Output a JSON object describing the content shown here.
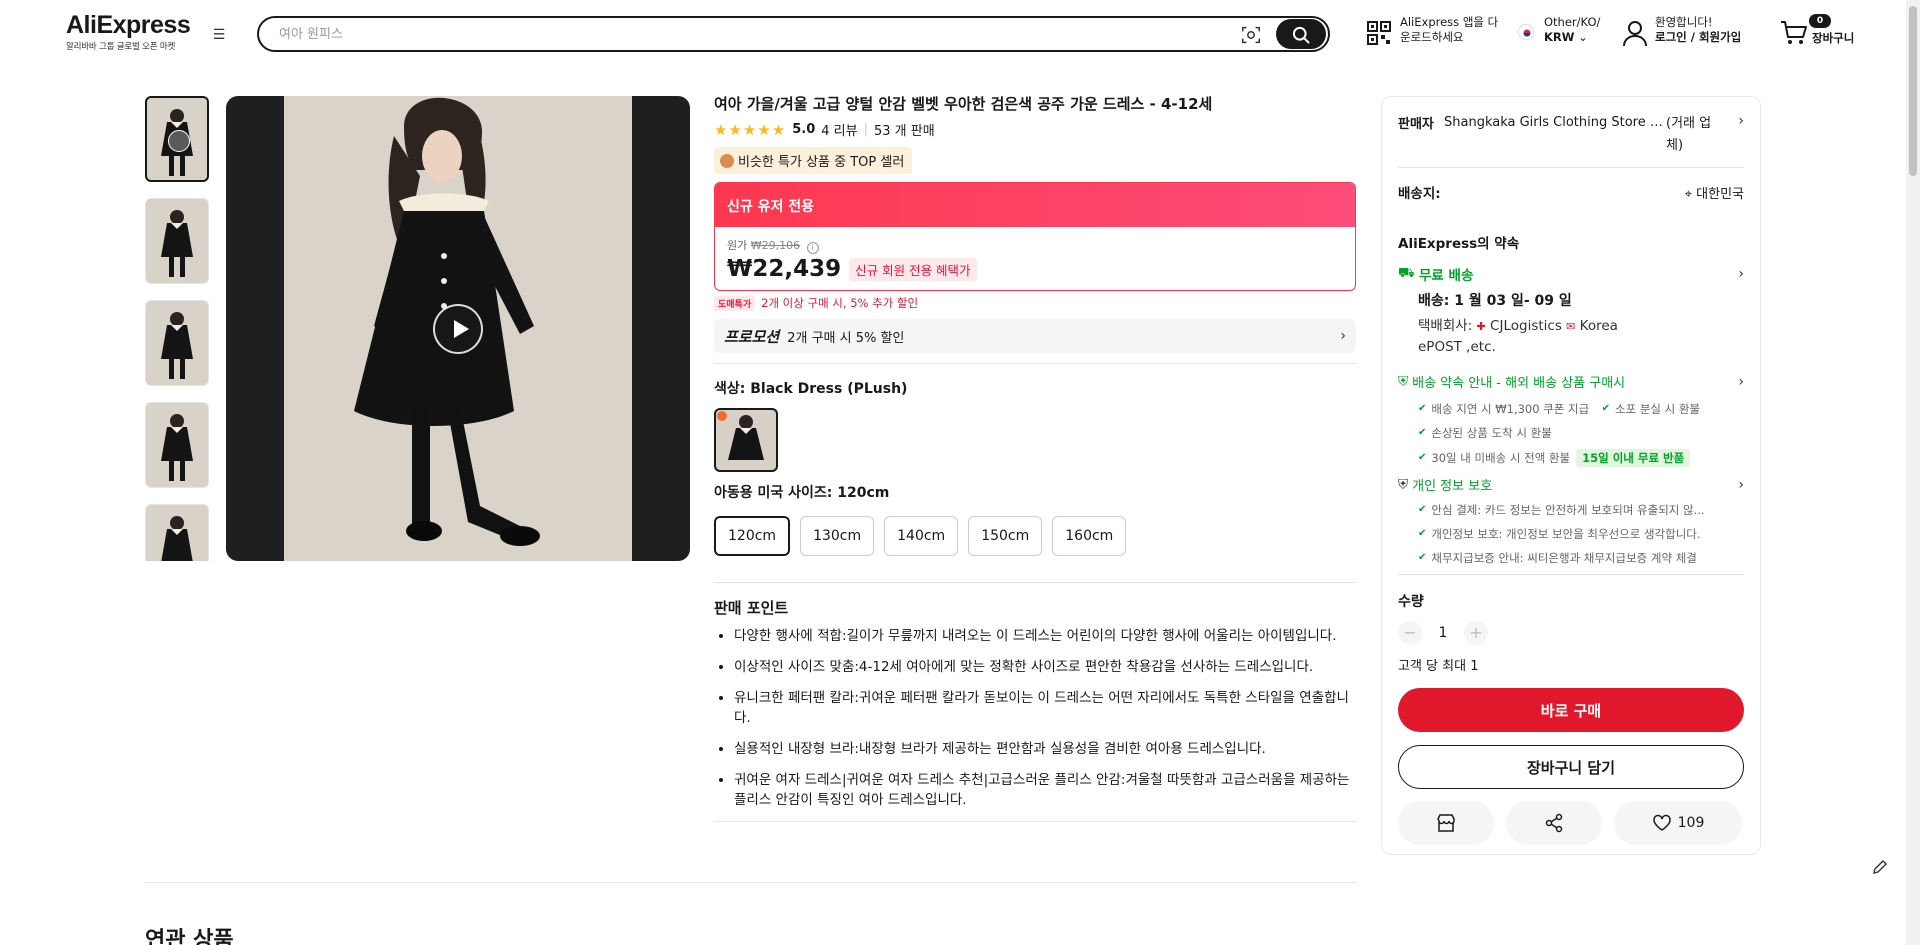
{
  "header": {
    "logo": "AliExpress",
    "logo_sub": "알리바바 그룹 글로벌 오픈 마켓",
    "search_placeholder": "여아 원피스",
    "app_promo_line1": "AliExpress 앱을 다",
    "app_promo_line2": "운로드하세요",
    "locale_line1": "Other/KO/",
    "locale_currency": "KRW",
    "welcome": "환영합니다!",
    "login": "로그인 / 회원가입",
    "cart_count": "0",
    "cart_label": "장바구니"
  },
  "product": {
    "title": "여아 가을/겨울 고급 양털 안감 벨벳 우아한 검은색 공주 가운 드레스 - 4-12세",
    "stars": "★★★★★",
    "rating": "5.0",
    "reviews": "4 리뷰",
    "sold": "53 개 판매",
    "top_badge": "비슷한 특가 상품 중 TOP 셀러",
    "price_header": "신규 유저 전용",
    "orig_label": "원가",
    "orig_price": "₩29,106",
    "price": "₩22,439",
    "newuser_tag": "신규 회원 전용 혜택가",
    "deal_tag": "도매특가",
    "deal_text": "2개 이상 구매 시, 5% 추가 할인",
    "promo_label": "프로모션",
    "promo_text": "2개 구매 시 5% 할인",
    "color_label": "색상:",
    "color_value": "Black Dress (PLush)",
    "size_label": "아동용 미국 사이즈:",
    "size_value": "120cm",
    "sizes": [
      "120cm",
      "130cm",
      "140cm",
      "150cm",
      "160cm"
    ],
    "selling_points_title": "판매 포인트",
    "selling_points": [
      "다양한 행사에 적합:길이가 무릎까지 내려오는 이 드레스는 어린이의 다양한 행사에 어울리는 아이템입니다.",
      "이상적인 사이즈 맞춤:4-12세 여아에게 맞는 정확한 사이즈로 편안한 착용감을 선사하는 드레스입니다.",
      "유니크한 페터팬 칼라:귀여운 페터팬 칼라가 돋보이는 이 드레스는 어떤 자리에서도 독특한 스타일을 연출합니다.",
      "실용적인 내장형 브라:내장형 브라가 제공하는 편안함과 실용성을 겸비한 여아용 드레스입니다.",
      "귀여운 여자 드레스|귀여운 여자 드레스 추천|고급스러운 플리스 안감:겨울철 따뜻함과 고급스러움을 제공하는 플리스 안감이 특징인 여아 드레스입니다."
    ]
  },
  "panel": {
    "seller_label": "판매자",
    "seller_name": "Shangkaka Girls Clothing Store S...",
    "seller_status": "(거래 업체)",
    "ship_to_label": "배송지:",
    "ship_to": "대한민국",
    "promise_title": "AliExpress의 약속",
    "free_shipping": "무료 배송",
    "delivery": "배송: 1 월 03 일- 09 일",
    "carrier_label": "택배회사:",
    "carrier_1": "CJLogistics",
    "carrier_2": "Korea",
    "carrier_3": "ePOST ,etc.",
    "guarantee_title": "배송 약속 안내 - 해외 배송 상품 구매시",
    "guarantee_items": [
      "배송 지연 시 ₩1,300 쿠폰 지급",
      "소포 분실 시 환불",
      "손상된 상품 도착 시 환불",
      "30일 내 미배송 시 전액 환불"
    ],
    "free_return": "15일 이내 무료 반품",
    "privacy_title": "개인 정보 보호",
    "privacy_items": [
      "안심 결제: 카드 정보는 안전하게 보호되며 유출되지 않...",
      "개인정보 보호: 개인정보 보안을 최우선으로 생각합니다.",
      "채무지급보증 안내: 씨티은행과 채무지급보증 계약 체결"
    ],
    "qty_label": "수량",
    "qty": "1",
    "qty_limit": "고객 당 최대 1",
    "buy_now": "바로 구매",
    "add_to_cart": "장바구니 담기",
    "wishlist_count": "109"
  },
  "related_title": "연관 상품",
  "colors": {
    "brand_red": "#e1182b",
    "price_red": "#fd384f",
    "green": "#00a32a",
    "star": "#fdb91a"
  }
}
